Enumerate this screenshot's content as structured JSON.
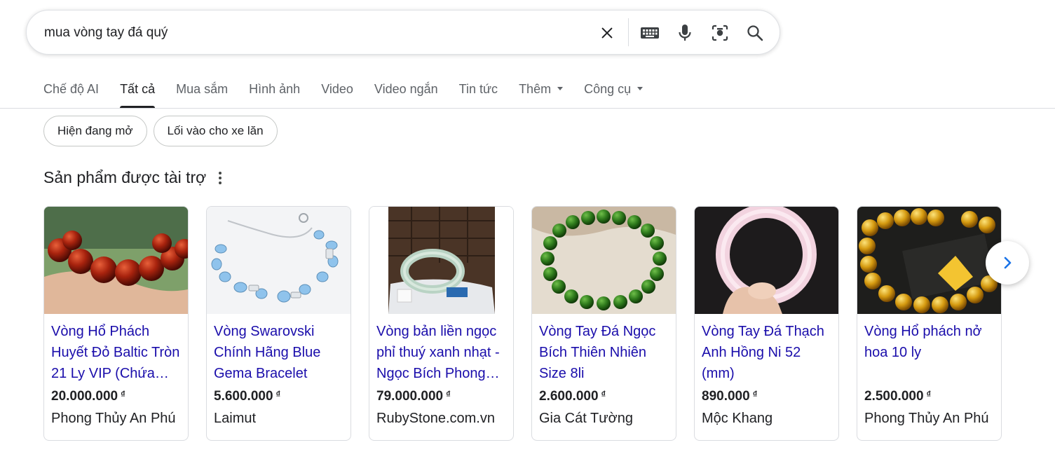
{
  "search": {
    "query": "mua vòng tay đá quý"
  },
  "icons": {
    "clear": "close-icon",
    "keyboard": "keyboard-icon",
    "voice": "microphone-icon",
    "lens": "camera-lens-icon",
    "search": "search-icon"
  },
  "tabs": [
    {
      "label": "Chế độ AI",
      "active": false
    },
    {
      "label": "Tất cả",
      "active": true
    },
    {
      "label": "Mua sắm",
      "active": false
    },
    {
      "label": "Hình ảnh",
      "active": false
    },
    {
      "label": "Video",
      "active": false
    },
    {
      "label": "Video ngắn",
      "active": false
    },
    {
      "label": "Tin tức",
      "active": false
    },
    {
      "label": "Thêm",
      "active": false
    },
    {
      "label": "Công cụ",
      "active": false
    }
  ],
  "chips": [
    {
      "label": "Hiện đang mở"
    },
    {
      "label": "Lối vào cho xe lăn"
    }
  ],
  "sponsored": {
    "title": "Sản phẩm được tài trợ"
  },
  "currency": "₫",
  "products": [
    {
      "title": "Vòng Hổ Phách Huyết Đỏ Baltic Tròn 21 Ly VIP (Chứa…",
      "price": "20.000.000",
      "store": "Phong Thủy An Phú"
    },
    {
      "title": "Vòng Swarovski Chính Hãng Blue Gema Bracelet",
      "price": "5.600.000",
      "store": "Laimut"
    },
    {
      "title": "Vòng bản liền ngọc phỉ thuý xanh nhạt - Ngọc Bích Phong…",
      "price": "79.000.000",
      "store": "RubyStone.com.vn"
    },
    {
      "title": "Vòng Tay Đá Ngọc Bích Thiên Nhiên Size 8li",
      "price": "2.600.000",
      "store": "Gia Cát Tường"
    },
    {
      "title": "Vòng Tay Đá Thạch Anh Hồng Ni 52 (mm)",
      "price": "890.000",
      "store": "Mộc Khang"
    },
    {
      "title": "Vòng Hổ phách nở hoa 10 ly",
      "price": "2.500.000",
      "store": "Phong Thủy An Phú"
    }
  ],
  "colors": {
    "link": "#1a0dab",
    "text": "#202124",
    "muted": "#5f6368",
    "border": "#dadce0"
  }
}
